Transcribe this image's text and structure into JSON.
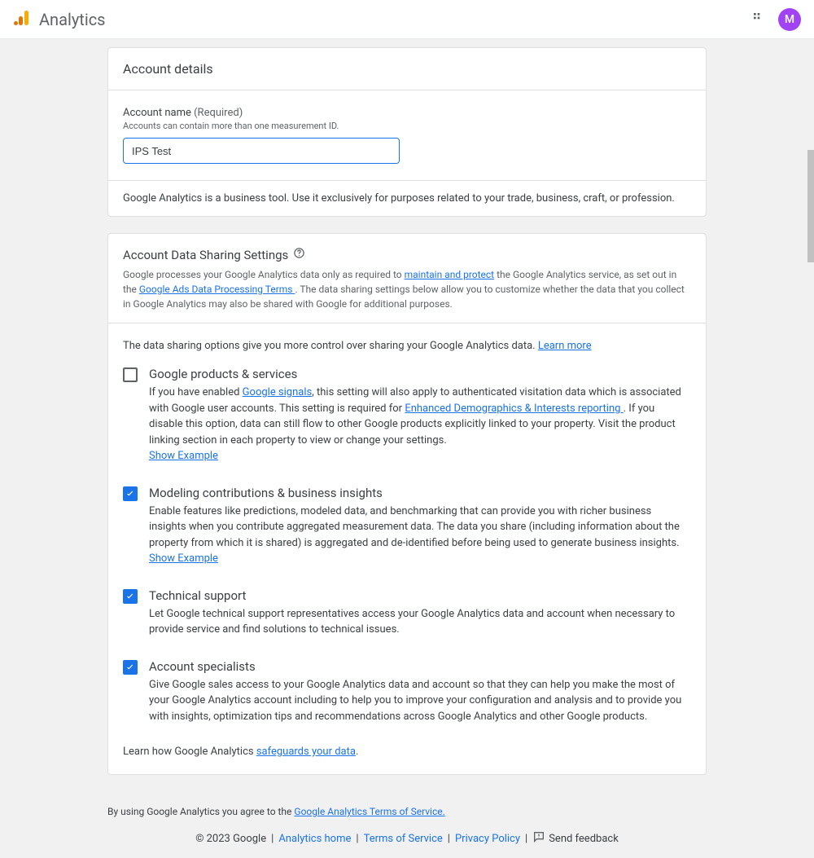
{
  "header": {
    "product_name": "Analytics",
    "avatar_initial": "M"
  },
  "card_details": {
    "title": "Account details",
    "name_label": "Account name",
    "required_suffix": "(Required)",
    "name_help": "Accounts can contain more than one measurement ID.",
    "name_value": "IPS Test",
    "business_note": "Google Analytics is a business tool. Use it exclusively for purposes related to your trade, business, craft, or profession."
  },
  "sharing": {
    "title": "Account Data Sharing Settings",
    "intro_before_link1": "Google processes your Google Analytics data only as required to ",
    "link_maintain": "maintain and protect",
    "intro_mid1": " the Google Analytics service, as set out in the ",
    "link_terms": "Google Ads Data Processing Terms ",
    "intro_after": ". The data sharing settings below allow you to customize whether the data that you collect in Google Analytics may also be shared with Google for additional purposes.",
    "options_intro_text": "The data sharing options give you more control over sharing your Google Analytics data. ",
    "learn_more": "Learn more"
  },
  "opt1": {
    "checked": false,
    "title": "Google products & services",
    "d_before": "If you have enabled ",
    "link_signals": "Google signals",
    "d_mid1": ", this setting will also apply to authenticated visitation data which is associated with Google user accounts. This setting is required for ",
    "link_demo": "Enhanced Demographics & Interests reporting ",
    "d_after": ". If you disable this option, data can still flow to other Google products explicitly linked to your property. Visit the product linking section in each property to view or change your settings.",
    "show_example": "Show Example"
  },
  "opt2": {
    "checked": true,
    "title": "Modeling contributions & business insights",
    "desc": "Enable features like predictions, modeled data, and benchmarking that can provide you with richer business insights when you contribute aggregated measurement data. The data you share (including information about the property from which it is shared) is aggregated and de-identified before being used to generate business insights. ",
    "show_example": "Show Example"
  },
  "opt3": {
    "checked": true,
    "title": "Technical support",
    "desc": "Let Google technical support representatives access your Google Analytics data and account when necessary to provide service and find solutions to technical issues."
  },
  "opt4": {
    "checked": true,
    "title": "Account specialists",
    "desc": "Give Google sales access to your Google Analytics data and account so that they can help you make the most of your Google Analytics account including to help you to improve your configuration and analysis and to provide you with insights, optimization tips and recommendations across Google Analytics and other Google products."
  },
  "safeguard": {
    "before": "Learn how Google Analytics ",
    "link": "safeguards your data",
    "after": "."
  },
  "agree": {
    "before": "By using Google Analytics you agree to the ",
    "link": "Google Analytics Terms of Service."
  },
  "footer": {
    "copyright": "© 2023 Google",
    "links": {
      "home": "Analytics home",
      "tos": "Terms of Service",
      "privacy": "Privacy Policy"
    },
    "feedback": "Send feedback"
  }
}
